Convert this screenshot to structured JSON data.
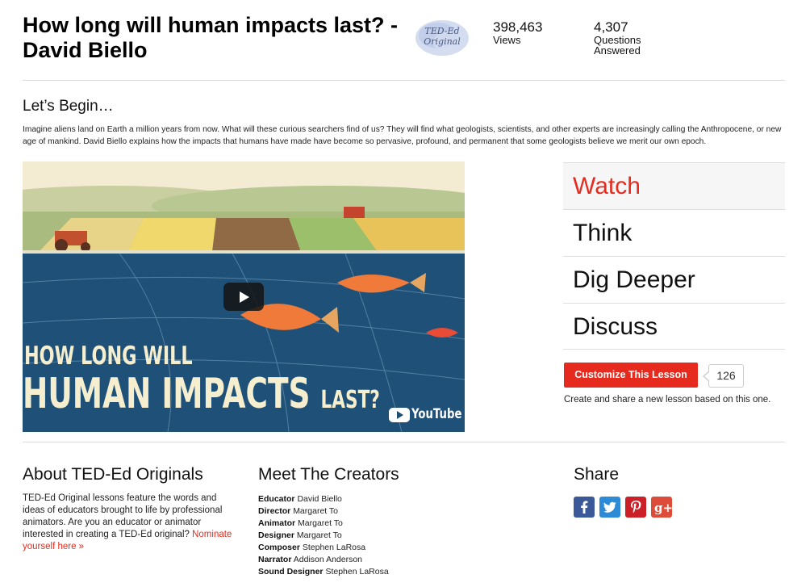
{
  "header": {
    "title": "How long will human impacts last? - David Biello",
    "badge_line1": "TED-Ed",
    "badge_line2": "Original",
    "views_count": "398,463",
    "views_label": "Views",
    "questions_count": "4,307",
    "questions_label_1": "Questions",
    "questions_label_2": "Answered"
  },
  "intro": {
    "heading": "Let’s Begin…",
    "text": "Imagine aliens land on Earth a million years from now. What will these curious searchers find of us? They will find what geologists, scientists, and other experts are increasingly calling the Anthropocene, or new age of mankind. David Biello explains how the impacts that humans have made have become so pervasive, profound, and permanent that some geologists believe we merit our own epoch."
  },
  "video": {
    "title_line1": "HOW LONG WILL",
    "title_line2": "HUMAN IMPACTS",
    "title_line2_small": "LAST?",
    "provider": "YouTube"
  },
  "nav": {
    "items": [
      {
        "label": "Watch",
        "active": true
      },
      {
        "label": "Think",
        "active": false
      },
      {
        "label": "Dig Deeper",
        "active": false
      },
      {
        "label": "Discuss",
        "active": false
      }
    ]
  },
  "customize": {
    "button_label": "Customize This Lesson",
    "count": "126",
    "description": "Create and share a new lesson based on this one."
  },
  "about": {
    "heading": "About TED-Ed Originals",
    "text": "TED-Ed Original lessons feature the words and ideas of educators brought to life by professional animators. Are you an educator or animator interested in creating a TED-Ed original?",
    "link": "Nominate yourself here »"
  },
  "creators": {
    "heading": "Meet The Creators",
    "list": [
      {
        "role": "Educator",
        "name": "David Biello"
      },
      {
        "role": "Director",
        "name": "Margaret To"
      },
      {
        "role": "Animator",
        "name": "Margaret To"
      },
      {
        "role": "Designer",
        "name": "Margaret To"
      },
      {
        "role": "Composer",
        "name": "Stephen LaRosa"
      },
      {
        "role": "Narrator",
        "name": "Addison Anderson"
      },
      {
        "role": "Sound Designer",
        "name": "Stephen LaRosa"
      }
    ]
  },
  "share": {
    "heading": "Share",
    "buttons": [
      {
        "icon": "facebook-icon",
        "glyph": "f",
        "color": "#3b5998"
      },
      {
        "icon": "twitter-icon",
        "glyph": "t",
        "color": "#2c8bd6"
      },
      {
        "icon": "pinterest-icon",
        "glyph": "p",
        "color": "#cb2027"
      },
      {
        "icon": "googleplus-icon",
        "glyph": "g+",
        "color": "#dd4b39"
      }
    ]
  },
  "colors": {
    "accent": "#e62b1e",
    "divider": "#dddddd"
  }
}
